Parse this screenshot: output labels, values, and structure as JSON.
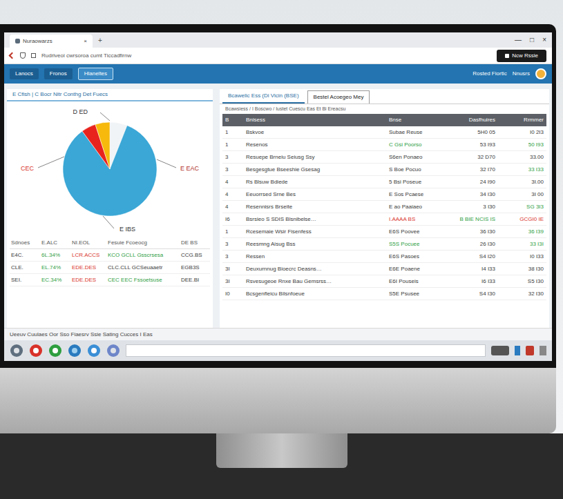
{
  "browser": {
    "tab_title": "Nuraowarzs",
    "tab_close": "×",
    "new_tab": "+",
    "address": "Rudriveoi cwrsoroa cumt Ticcadfirnw",
    "window_controls": [
      "—",
      "□",
      "×"
    ],
    "action_button": "Ncw Rssie"
  },
  "header": {
    "buttons": [
      {
        "label": "Lanocs",
        "selected": false
      },
      {
        "label": "Fronos",
        "selected": false
      },
      {
        "label": "Hlaneltes",
        "selected": true
      }
    ],
    "links": [
      "Rosted Fiortic",
      "Nnusrs"
    ]
  },
  "left_panel": {
    "title": "E Cfish | C Bocr Nitr Conthg Det Fuecs",
    "chart": {
      "values": [
        6,
        84,
        5,
        5
      ],
      "colors": [
        "#f1f4f6",
        "#3aa7d6",
        "#e8231e",
        "#f6b90c"
      ],
      "labels": [
        {
          "text": "D ED",
          "color": "#333333"
        },
        {
          "text": "CEC",
          "color": "#d9342b"
        },
        {
          "text": "E EAC",
          "color": "#b0302a"
        },
        {
          "text": "E IBS",
          "color": "#333333"
        }
      ]
    },
    "table": {
      "columns": [
        "Sdnoes",
        "E.ALC",
        "NI.EOL",
        "Fesuie Fcoeocg",
        "DE BS"
      ],
      "rows": [
        [
          {
            "text": "E4C.",
            "color": "#3a3a3a"
          },
          {
            "text": "6L.34%",
            "color": "#2e9e3f"
          },
          {
            "text": "LCR.ACCS",
            "color": "#d9342b"
          },
          {
            "text": "KCO GCLL Gsscrsesa",
            "color": "#2e9e3f"
          },
          {
            "text": "CCG.BS",
            "color": "#3a3a3a"
          }
        ],
        [
          {
            "text": "CLE.",
            "color": "#3a3a3a"
          },
          {
            "text": "EL.74%",
            "color": "#2e9e3f"
          },
          {
            "text": "EDE.DES",
            "color": "#d9342b"
          },
          {
            "text": "CLC.CLL GCSeuaaetr",
            "color": "#3a3a3a"
          },
          {
            "text": "EGB3S",
            "color": "#3a3a3a"
          }
        ],
        [
          {
            "text": "SEI.",
            "color": "#3a3a3a"
          },
          {
            "text": "EC.34%",
            "color": "#2e9e3f"
          },
          {
            "text": "EDE.DES",
            "color": "#d9342b"
          },
          {
            "text": "CEC EEC Fssoetsuse",
            "color": "#2e9e3f"
          },
          {
            "text": "DEE.BI",
            "color": "#3a3a3a"
          }
        ]
      ]
    }
  },
  "right_panel": {
    "tabs": [
      {
        "label": "Bcawelic Ess (Di Vicin (BSE)",
        "selected": false
      },
      {
        "label": "Bestel Acoegeo Mey",
        "selected": true
      }
    ],
    "breadcrumb": "Bcawsiess / I Boscwo / Iustet Cuescu Eas Et Bi Ereacsu",
    "table": {
      "columns": [
        "B",
        "Bnisess",
        "Bnse",
        "Dasfhuires",
        "Rrmmer"
      ],
      "rows": [
        [
          {
            "text": "1",
            "color": "#3a3a3a"
          },
          {
            "text": "Bskvoe",
            "color": "#3a3a3a"
          },
          {
            "text": "Subae Reuse",
            "color": "#3a3a3a"
          },
          {
            "text": "5H0 05",
            "color": "#3a3a3a"
          },
          {
            "text": "I0 2I3",
            "color": "#3a3a3a"
          }
        ],
        [
          {
            "text": "1",
            "color": "#3a3a3a"
          },
          {
            "text": "Resenos",
            "color": "#3a3a3a"
          },
          {
            "text": "C Gsi Poorso",
            "color": "#2e9e3f"
          },
          {
            "text": "53 I93",
            "color": "#3a3a3a"
          },
          {
            "text": "50 I93",
            "color": "#2e9e3f"
          }
        ],
        [
          {
            "text": "3",
            "color": "#3a3a3a"
          },
          {
            "text": "Resuepe Brneiu Seiusg Ssy",
            "color": "#3a3a3a"
          },
          {
            "text": "S6en Ponaeo",
            "color": "#3a3a3a"
          },
          {
            "text": "32 D70",
            "color": "#3a3a3a"
          },
          {
            "text": "33.00",
            "color": "#3a3a3a"
          }
        ],
        [
          {
            "text": "3",
            "color": "#3a3a3a"
          },
          {
            "text": "Besgesgtue Bseeshie Gsesag",
            "color": "#3a3a3a"
          },
          {
            "text": "S Boe Pocuo",
            "color": "#3a3a3a"
          },
          {
            "text": "32 I70",
            "color": "#3a3a3a"
          },
          {
            "text": "33 I33",
            "color": "#2e9e3f"
          }
        ],
        [
          {
            "text": "4",
            "color": "#3a3a3a"
          },
          {
            "text": "Rs Blsuw Bdiede",
            "color": "#3a3a3a"
          },
          {
            "text": "5 Bsi Poseue",
            "color": "#3a3a3a"
          },
          {
            "text": "24 I90",
            "color": "#3a3a3a"
          },
          {
            "text": "3I.00",
            "color": "#3a3a3a"
          }
        ],
        [
          {
            "text": "4",
            "color": "#3a3a3a"
          },
          {
            "text": "Eeuorrsed Srne Bes",
            "color": "#3a3a3a"
          },
          {
            "text": "E Sos Pcaese",
            "color": "#3a3a3a"
          },
          {
            "text": "34 I30",
            "color": "#3a3a3a"
          },
          {
            "text": "3I 00",
            "color": "#3a3a3a"
          }
        ],
        [
          {
            "text": "4",
            "color": "#3a3a3a"
          },
          {
            "text": "Resennisrs Brseite",
            "color": "#3a3a3a"
          },
          {
            "text": "E ao Paaiaeo",
            "color": "#3a3a3a"
          },
          {
            "text": "3 I30",
            "color": "#3a3a3a"
          },
          {
            "text": "SG 3I3",
            "color": "#2e9e3f"
          }
        ],
        [
          {
            "text": "I6",
            "color": "#3a3a3a"
          },
          {
            "text": "Bsrsieo S SDIS Blsnibelse…",
            "color": "#3a3a3a"
          },
          {
            "text": "I.AAAA BS",
            "color": "#d9342b"
          },
          {
            "text": "B BIE NCIS IS",
            "color": "#2e9e3f"
          },
          {
            "text": "GCGI0 IE",
            "color": "#d9342b"
          }
        ],
        [
          {
            "text": "1",
            "color": "#3a3a3a"
          },
          {
            "text": "Rcesemaie Wsir Fisenfess",
            "color": "#3a3a3a"
          },
          {
            "text": "E6S Poovee",
            "color": "#3a3a3a"
          },
          {
            "text": "36 I30",
            "color": "#3a3a3a"
          },
          {
            "text": "36 I39",
            "color": "#2e9e3f"
          }
        ],
        [
          {
            "text": "3",
            "color": "#3a3a3a"
          },
          {
            "text": "Reesmng Aisug Bss",
            "color": "#3a3a3a"
          },
          {
            "text": "S5S Pocuee",
            "color": "#2e9e3f"
          },
          {
            "text": "26 I30",
            "color": "#3a3a3a"
          },
          {
            "text": "33 I3I",
            "color": "#2e9e3f"
          }
        ],
        [
          {
            "text": "3",
            "color": "#3a3a3a"
          },
          {
            "text": "Ressen",
            "color": "#3a3a3a"
          },
          {
            "text": "E6S Pasoes",
            "color": "#3a3a3a"
          },
          {
            "text": "S4 I20",
            "color": "#3a3a3a"
          },
          {
            "text": "I0 I33",
            "color": "#3a3a3a"
          }
        ],
        [
          {
            "text": "3I",
            "color": "#3a3a3a"
          },
          {
            "text": "Deuxurnnug Bioecrc Deasns…",
            "color": "#3a3a3a"
          },
          {
            "text": "E6E Poaene",
            "color": "#3a3a3a"
          },
          {
            "text": "I4 I33",
            "color": "#3a3a3a"
          },
          {
            "text": "38 I30",
            "color": "#3a3a3a"
          }
        ],
        [
          {
            "text": "3I",
            "color": "#3a3a3a"
          },
          {
            "text": "Rsvesugeoe Rnxe Bau Gemsrss…",
            "color": "#3a3a3a"
          },
          {
            "text": "E6I Pouseis",
            "color": "#3a3a3a"
          },
          {
            "text": "I6 I33",
            "color": "#3a3a3a"
          },
          {
            "text": "S5 I30",
            "color": "#3a3a3a"
          }
        ],
        [
          {
            "text": "I0",
            "color": "#3a3a3a"
          },
          {
            "text": "Bcsgenfleicu Bilsnfoeue",
            "color": "#3a3a3a"
          },
          {
            "text": "S5E Psusee",
            "color": "#3a3a3a"
          },
          {
            "text": "S4 I30",
            "color": "#3a3a3a"
          },
          {
            "text": "32 I30",
            "color": "#3a3a3a"
          }
        ]
      ]
    }
  },
  "status_bar": "Ueeuv Cuulaes Oor Sso Fiaesrv Ssie Sating Cucces I Eas"
}
